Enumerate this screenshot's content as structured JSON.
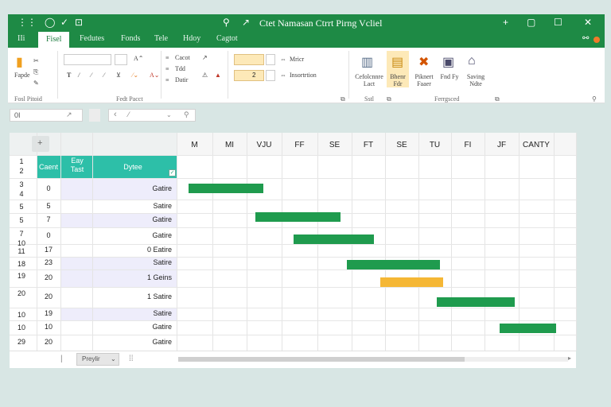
{
  "titlebar": {
    "title": "Ctet Namasan Ctrrt Pirng Vcliel"
  },
  "tabs": [
    "Fisel",
    "Fedutes",
    "Fonds",
    "Tele",
    "Hdoy",
    "Cagtot"
  ],
  "home_tab": "IIi",
  "ribbon": {
    "paste": "Fapde",
    "font_group": "Fosl Pitoid",
    "font_label": "Fedt Pacct",
    "format_a": "Cacot",
    "format_b": "Tdd",
    "format_c": "Datir",
    "merge_a": "Mricr",
    "merge_b": "Insortrtion",
    "number_value": "2",
    "group_label_mid": "Sstl",
    "group_label_right": "Ferrgsced",
    "btn1": "Cefolcnnre Lact",
    "btn2": "Bhenr Fdr",
    "btn3": "Piknert Faaer",
    "btn4": "Fnd Fy",
    "btn5": "Saving Ndte"
  },
  "formula": {
    "namebox": "0I"
  },
  "grid": {
    "corner_label": "+",
    "col_a_header": "Caent",
    "col_b_header": "Eay Tast",
    "col_c_header": "Dytee",
    "date_headers": [
      "M",
      "MI",
      "VJU",
      "FF",
      "SE",
      "FT",
      "SE",
      "TU",
      "FI",
      "JF",
      "CANTY"
    ],
    "rows": [
      {
        "num": "1\n2",
        "a": "",
        "c": ""
      },
      {
        "num": "3\n4",
        "a": "0",
        "c": "Gatire"
      },
      {
        "num": "5",
        "a": "5",
        "c": "Satire"
      },
      {
        "num": "5",
        "a": "7",
        "c": "Gatire"
      },
      {
        "num": "7\n10",
        "a": "0",
        "c": "Gatire"
      },
      {
        "num": "11",
        "a": "17",
        "c": "0 Eatire"
      },
      {
        "num": "18",
        "a": "23",
        "c": "Satire"
      },
      {
        "num": "19",
        "a": "20",
        "c": "1 Geins"
      },
      {
        "num": "20",
        "a": "20",
        "c": "1 Satire"
      },
      {
        "num": "10",
        "a": "19",
        "c": "Satire"
      },
      {
        "num": "10",
        "a": "10",
        "c": "Gatire"
      },
      {
        "num": "29",
        "a": "20",
        "c": "Gatire"
      }
    ],
    "bars": [
      {
        "row": 1,
        "start": 0.0,
        "end": 2.8,
        "color": "#1f9b4e"
      },
      {
        "row": 3,
        "start": 1.9,
        "end": 5.0,
        "color": "#1f9b4e"
      },
      {
        "row": 4,
        "start": 3.0,
        "end": 6.0,
        "color": "#1f9b4e"
      },
      {
        "row": 6,
        "start": 4.5,
        "end": 8.0,
        "color": "#1f9b4e"
      },
      {
        "row": 7,
        "start": 5.5,
        "end": 8.1,
        "color": "#f5b735"
      },
      {
        "row": 8,
        "start": 7.2,
        "end": 10.2,
        "color": "#1f9b4e"
      },
      {
        "row": 9,
        "start": 9.1,
        "end": 11.6,
        "color": "#1f9b4e"
      }
    ]
  },
  "statusbar": {
    "sheet_tab": "Preylir"
  },
  "colors": {
    "accent_green": "#1e8a45",
    "teal_header": "#2dbfa8",
    "lavender": "#eeedfb",
    "bar_green": "#1f9b4e",
    "bar_orange": "#f5b735"
  }
}
